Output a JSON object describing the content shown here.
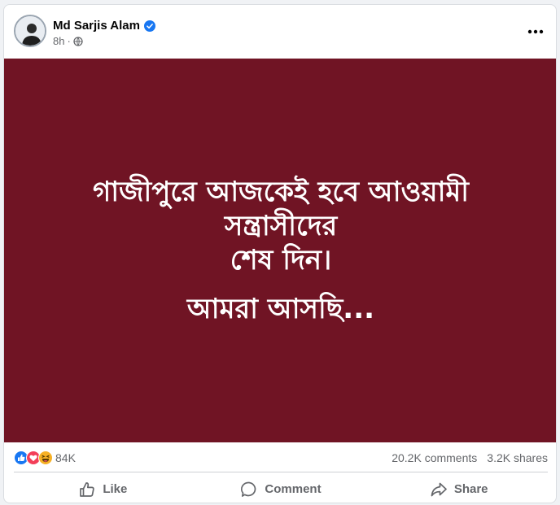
{
  "post": {
    "author": "Md Sarjis Alam",
    "time": "8h",
    "separator": "·",
    "image_text": {
      "line1": "গাজীপুরে আজকেই হবে আওয়ামী",
      "line2": "সন্ত্রাসীদের",
      "line3": "শেষ দিন।",
      "line4": "আমরা আসছি..."
    },
    "image_bg_color": "#701424",
    "reactions": {
      "icons": [
        "like-reaction-icon",
        "love-reaction-icon",
        "haha-reaction-icon"
      ],
      "count": "84K"
    },
    "comments": "20.2K comments",
    "shares": "3.2K shares"
  },
  "actions": {
    "like": "Like",
    "comment": "Comment",
    "share": "Share"
  }
}
